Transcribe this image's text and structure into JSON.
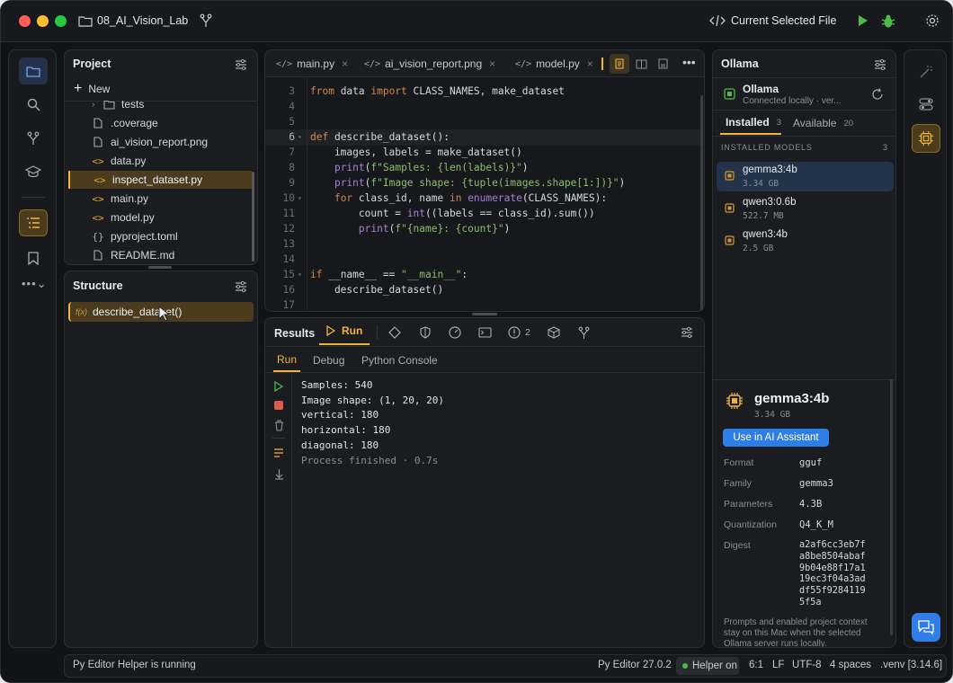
{
  "window": {
    "project_name": "08_AI_Vision_Lab",
    "run_config": "Current Selected File"
  },
  "project": {
    "title": "Project",
    "new_label": "New",
    "files": [
      {
        "name": "tests",
        "icon": "folder-icon"
      },
      {
        "name": ".coverage",
        "icon": "file-icon"
      },
      {
        "name": "ai_vision_report.png",
        "icon": "image-file-icon"
      },
      {
        "name": "data.py",
        "icon": "python-file-icon"
      },
      {
        "name": "inspect_dataset.py",
        "icon": "python-file-icon",
        "selected": true
      },
      {
        "name": "main.py",
        "icon": "python-file-icon"
      },
      {
        "name": "model.py",
        "icon": "python-file-icon"
      },
      {
        "name": "pyproject.toml",
        "icon": "toml-file-icon"
      },
      {
        "name": "README.md",
        "icon": "markdown-file-icon"
      }
    ]
  },
  "structure": {
    "title": "Structure",
    "item_prefix": "f(x)",
    "item_label": "describe_dataset()"
  },
  "editor": {
    "tabs": [
      {
        "label": "main.py"
      },
      {
        "label": "ai_vision_report.png"
      },
      {
        "label": "model.py"
      }
    ],
    "lines": [
      {
        "n": "3",
        "text": "from data import CLASS_NAMES, make_dataset"
      },
      {
        "n": "4",
        "text": ""
      },
      {
        "n": "5",
        "text": ""
      },
      {
        "n": "6",
        "text": "def describe_dataset():"
      },
      {
        "n": "7",
        "text": "    images, labels = make_dataset()"
      },
      {
        "n": "8",
        "text": "    print(f\"Samples: {len(labels)}\")"
      },
      {
        "n": "9",
        "text": "    print(f\"Image shape: {tuple(images.shape[1:])}\")"
      },
      {
        "n": "10",
        "text": "    for class_id, name in enumerate(CLASS_NAMES):"
      },
      {
        "n": "11",
        "text": "        count = int((labels == class_id).sum())"
      },
      {
        "n": "12",
        "text": "        print(f\"{name}: {count}\")"
      },
      {
        "n": "13",
        "text": ""
      },
      {
        "n": "14",
        "text": ""
      },
      {
        "n": "15",
        "text": "if __name__ == \"__main__\":"
      },
      {
        "n": "16",
        "text": "    describe_dataset()"
      },
      {
        "n": "17",
        "text": ""
      }
    ]
  },
  "results": {
    "title": "Results",
    "run_tab": "Run",
    "problems_count": "2",
    "subtabs": [
      "Run",
      "Debug",
      "Python Console"
    ],
    "output": [
      "Samples: 540",
      "Image shape: (1, 20, 20)",
      "vertical: 180",
      "horizontal: 180",
      "diagonal: 180"
    ],
    "finished": "Process finished · 0.7s"
  },
  "ollama": {
    "title": "Ollama",
    "server_name": "Ollama",
    "server_status": "Connected locally · ver...",
    "tab_installed": "Installed",
    "installed_count": "3",
    "tab_available": "Available",
    "available_count": "20",
    "section_label": "INSTALLED MODELS",
    "section_count": "3",
    "models": [
      {
        "name": "gemma3:4b",
        "size": "3.34 GB"
      },
      {
        "name": "qwen3:0.6b",
        "size": "522.7 MB"
      },
      {
        "name": "qwen3:4b",
        "size": "2.5 GB"
      }
    ],
    "detail": {
      "name": "gemma3:4b",
      "size": "3.34 GB",
      "use_button": "Use in AI Assistant",
      "format_label": "Format",
      "format": "gguf",
      "family_label": "Family",
      "family": "gemma3",
      "params_label": "Parameters",
      "params": "4.3B",
      "quant_label": "Quantization",
      "quant": "Q4_K_M",
      "digest_label": "Digest",
      "digest": [
        "a2af6cc3eb7f",
        "a8be8504abaf",
        "9b04e88f17a1",
        "19ec3f04a3ad",
        "df55f9284119",
        "5f5a"
      ],
      "note": [
        "Prompts and enabled project context",
        "stay on this Mac when the selected",
        "Ollama server runs locally."
      ]
    }
  },
  "statusbar": {
    "helper_running": "Py Editor Helper is running",
    "version": "Py Editor 27.0.2",
    "helper_on": "Helper on",
    "position": "6:1",
    "line_sep": "LF",
    "encoding": "UTF-8",
    "indent": "4 spaces",
    "venv": ".venv [3.14.6]"
  },
  "colors": {
    "accent": "#f0b43c",
    "selection": "#4a3c1c",
    "model_selected": "#23334a",
    "primary_button": "#2f7ee8",
    "run_green": "#4cbb4c"
  }
}
